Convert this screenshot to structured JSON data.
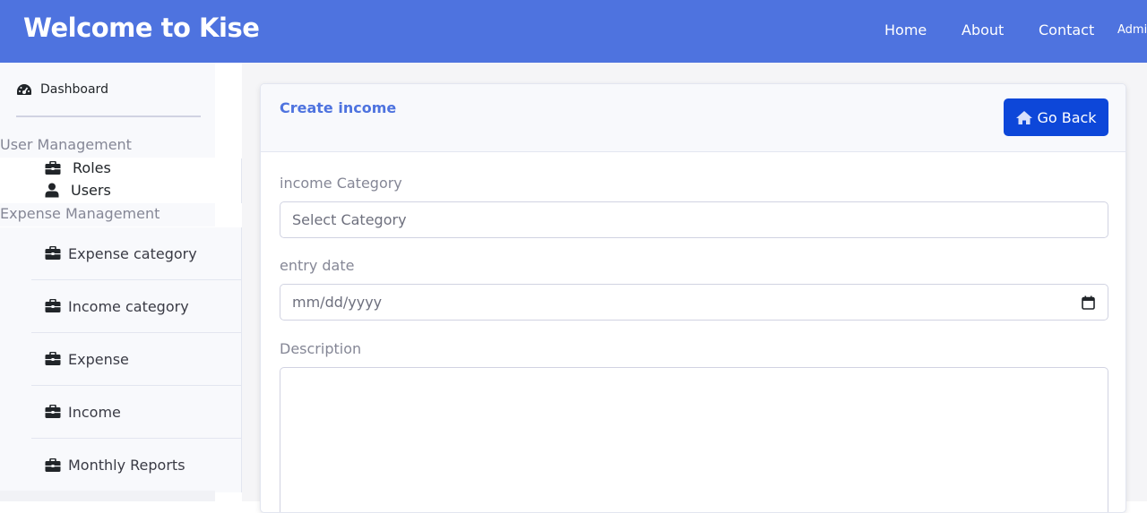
{
  "navbar": {
    "brand": "Welcome to Kise",
    "links": {
      "home": "Home",
      "about": "About",
      "contact": "Contact",
      "admin": "Admi"
    }
  },
  "sidebar": {
    "dashboard": {
      "label": "Dashboard",
      "icon": "tachometer-icon"
    },
    "sections": {
      "user": {
        "title": "User Management",
        "items": [
          {
            "label": "Roles",
            "icon": "briefcase-icon"
          },
          {
            "label": "Users",
            "icon": "user-icon"
          }
        ]
      },
      "expense": {
        "title": "Expense Management",
        "items": [
          {
            "label": "Expense category",
            "icon": "briefcase-icon"
          },
          {
            "label": "Income category",
            "icon": "briefcase-icon"
          },
          {
            "label": "Expense",
            "icon": "briefcase-icon"
          },
          {
            "label": "Income",
            "icon": "briefcase-icon"
          },
          {
            "label": "Monthly Reports",
            "icon": "briefcase-icon"
          }
        ]
      }
    }
  },
  "card": {
    "title": "Create income",
    "back_button": {
      "label": "Go Back",
      "icon": "home-icon"
    },
    "form": {
      "category": {
        "label": "income Category",
        "placeholder": "Select Category"
      },
      "entry_date": {
        "label": "entry date",
        "placeholder": "mm/dd/yyyy",
        "icon": "calendar-icon"
      },
      "description": {
        "label": "Description",
        "value": ""
      }
    }
  },
  "colors": {
    "primary": "#4e73df",
    "button": "#0d47d9",
    "muted_text": "#858796",
    "sidebar_bg": "#f8f9fc"
  }
}
